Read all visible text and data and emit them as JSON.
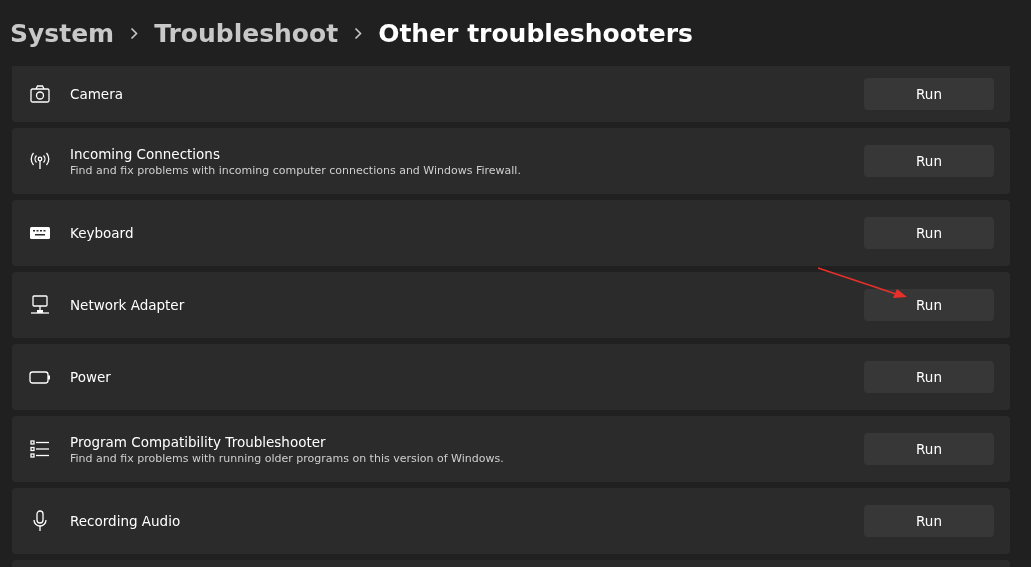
{
  "breadcrumb": [
    {
      "label": "System",
      "current": false
    },
    {
      "label": "Troubleshoot",
      "current": false
    },
    {
      "label": "Other troubleshooters",
      "current": true
    }
  ],
  "troubleshooters": [
    {
      "kind": "camera",
      "title": "Camera",
      "button": "Run"
    },
    {
      "kind": "antenna",
      "title": "Incoming Connections",
      "description": "Find and fix problems with incoming computer connections and Windows Firewall.",
      "button": "Run"
    },
    {
      "kind": "keyboard",
      "title": "Keyboard",
      "button": "Run"
    },
    {
      "kind": "network",
      "title": "Network Adapter",
      "button": "Run"
    },
    {
      "kind": "battery",
      "title": "Power",
      "button": "Run"
    },
    {
      "kind": "list",
      "title": "Program Compatibility Troubleshooter",
      "description": "Find and fix problems with running older programs on this version of Windows.",
      "button": "Run"
    },
    {
      "kind": "microphone",
      "title": "Recording Audio",
      "button": "Run"
    }
  ]
}
